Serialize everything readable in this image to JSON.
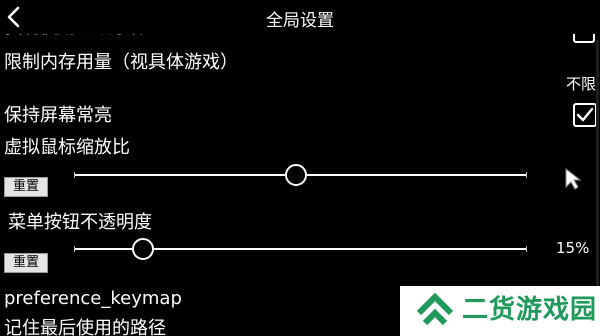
{
  "header": {
    "title": "全局设置"
  },
  "settings": {
    "clipped_row_label": "强制使用默认字体",
    "memory_limit_label": "限制内存用量（视具体游戏）",
    "memory_limit_value": "不限",
    "keep_screen_on_label": "保持屏幕常亮",
    "keep_screen_on_checked": true,
    "mouse_scale_label": "虚拟鼠标缩放比",
    "mouse_scale_reset": "重置",
    "mouse_scale_level": 0.49,
    "menu_opacity_label": "菜单按钮不透明度",
    "menu_opacity_reset": "重置",
    "menu_opacity_value": "15%",
    "menu_opacity_level": 0.15,
    "keymap_label": "preference_keymap",
    "remember_path_label": "记住最后使用的路径"
  },
  "watermark": {
    "text": "二货游戏园",
    "color": "#1f9a5a"
  }
}
